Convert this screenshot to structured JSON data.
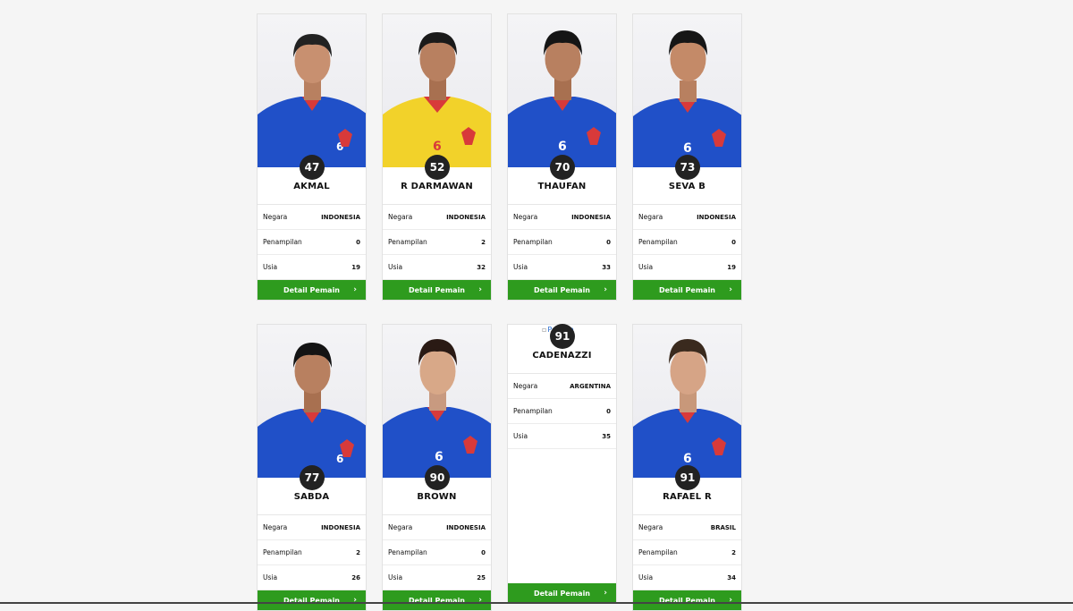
{
  "labels": {
    "country": "Negara",
    "appearances": "Penampilan",
    "age": "Usia",
    "detail_button": "Detail Pemain",
    "chevron": "›"
  },
  "colors": {
    "accent_green": "#2e9b1e",
    "number_badge": "#222222",
    "jersey_blue": "#2050c8",
    "jersey_yellow": "#f2d22a"
  },
  "players": [
    {
      "number": "47",
      "name": "AKMAL",
      "country": "INDONESIA",
      "appearances": "0",
      "age": "19",
      "kit": "blue",
      "photo": true
    },
    {
      "number": "52",
      "name": "R DARMAWAN",
      "country": "INDONESIA",
      "appearances": "2",
      "age": "32",
      "kit": "yellow",
      "photo": true
    },
    {
      "number": "70",
      "name": "THAUFAN",
      "country": "INDONESIA",
      "appearances": "0",
      "age": "33",
      "kit": "blue",
      "photo": true
    },
    {
      "number": "73",
      "name": "SEVA B",
      "country": "INDONESIA",
      "appearances": "0",
      "age": "19",
      "kit": "blue",
      "photo": true
    },
    {
      "number": "77",
      "name": "SABDA",
      "country": "INDONESIA",
      "appearances": "2",
      "age": "26",
      "kit": "blue",
      "photo": true
    },
    {
      "number": "90",
      "name": "BROWN",
      "country": "INDONESIA",
      "appearances": "0",
      "age": "25",
      "kit": "blue",
      "photo": true
    },
    {
      "number": "91",
      "name": "CADENAZZI",
      "country": "ARGENTINA",
      "appearances": "0",
      "age": "35",
      "kit": "none",
      "photo": false,
      "broken_alt": "Pemain"
    },
    {
      "number": "91",
      "name": "RAFAEL R",
      "country": "BRASIL",
      "appearances": "2",
      "age": "34",
      "kit": "blue",
      "photo": true
    }
  ]
}
